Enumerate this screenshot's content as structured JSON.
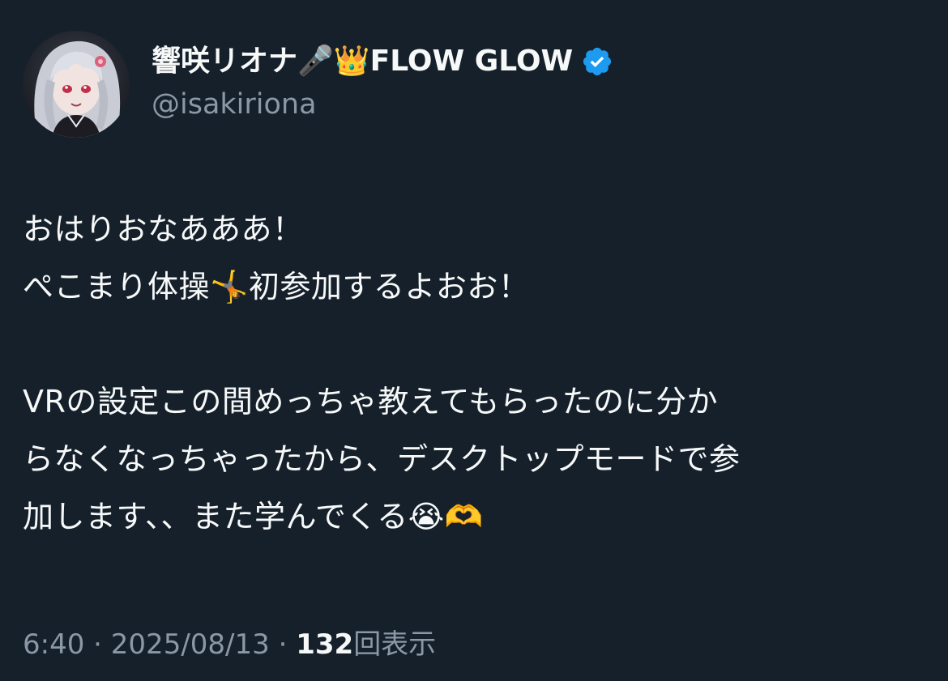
{
  "author": {
    "display_name": "響咲リオナ🎤👑FLOW GLOW",
    "handle": "@isakiriona",
    "verified": true,
    "verified_color": "#1d9bf0"
  },
  "tweet": {
    "text": "おはりおなあああ！\nぺこまり体操🤸初参加するよおお！\n\nVRの設定この間めっちゃ教えてもらったのに分か\nらなくなっちゃったから、デスクトップモードで参\n加します、、また学んでくる😭🫶"
  },
  "meta": {
    "time": "6:40",
    "separator": "·",
    "date": "2025/08/13",
    "views_count": "132",
    "views_label": "回表示"
  },
  "colors": {
    "background": "#15202b",
    "primary_text": "#f7f9f9",
    "secondary_text": "#8b98a5"
  }
}
